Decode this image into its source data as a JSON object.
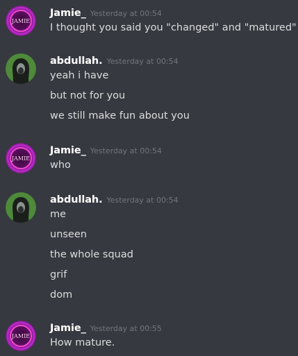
{
  "messages": [
    {
      "author": "Jamie_",
      "time": "Yesterday at 00:54",
      "avatar": "jamie-neon-avatar",
      "lines": [
        "I thought you said you \"changed\" and \"matured\""
      ]
    },
    {
      "author": "abdullah.",
      "time": "Yesterday at 00:54",
      "avatar": "hooded-figure-avatar",
      "lines": [
        "yeah i have",
        "but not for you",
        "we still make fun about you"
      ]
    },
    {
      "author": "Jamie_",
      "time": "Yesterday at 00:54",
      "avatar": "jamie-neon-avatar",
      "lines": [
        "who"
      ]
    },
    {
      "author": "abdullah.",
      "time": "Yesterday at 00:54",
      "avatar": "hooded-figure-avatar",
      "lines": [
        "me",
        "unseen",
        "the whole squad",
        "grif",
        "dom"
      ]
    },
    {
      "author": "Jamie_",
      "time": "Yesterday at 00:55",
      "avatar": "jamie-neon-avatar",
      "lines": [
        "How mature."
      ]
    }
  ],
  "avatar_text": {
    "jamie": "JAMIE"
  },
  "colors": {
    "background": "#36393f",
    "username": "#ffffff",
    "timestamp": "#72767d",
    "message_text": "#dcddde",
    "abdullah_avatar_bg": "#4e8a3a"
  }
}
